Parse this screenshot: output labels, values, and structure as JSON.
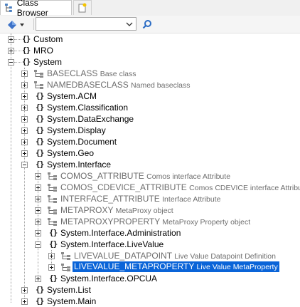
{
  "tabs": {
    "class_browser": "Class Browser"
  },
  "toolbar": {
    "search_value": "",
    "search_placeholder": ""
  },
  "tree": {
    "custom": "Custom",
    "mro": "MRO",
    "system": "System",
    "baseclass_name": "BASECLASS",
    "baseclass_desc": "Base class",
    "namedbaseclass_name": "NAMEDBASECLASS",
    "namedbaseclass_desc": "Named baseclass",
    "acm": "System.ACM",
    "classification": "System.Classification",
    "dataexchange": "System.DataExchange",
    "display": "System.Display",
    "document": "System.Document",
    "geo": "System.Geo",
    "interface": "System.Interface",
    "comos_attribute_name": "COMOS_ATTRIBUTE",
    "comos_attribute_desc": "Comos interface Attribute",
    "comos_cdevice_name": "COMOS_CDEVICE_ATTRIBUTE",
    "comos_cdevice_desc": "Comos CDEVICE interface Attribute",
    "interface_attribute_name": "INTERFACE_ATTRIBUTE",
    "interface_attribute_desc": "Interface Attribute",
    "metaproxy_name": "METAPROXY",
    "metaproxy_desc": "MetaProxy object",
    "metaproxyproperty_name": "METAPROXYPROPERTY",
    "metaproxyproperty_desc": "MetaProxy Property object",
    "administration": "System.Interface.Administration",
    "livevalue": "System.Interface.LiveValue",
    "lv_datapoint_name": "LIVEVALUE_DATAPOINT",
    "lv_datapoint_desc": "Live Value Datapoint Definition",
    "lv_metaproperty_name": "LIVEVALUE_METAPROPERTY",
    "lv_metaproperty_desc": "Live Value MetaProperty",
    "opcua": "System.Interface.OPCUA",
    "list": "System.List",
    "main": "System.Main"
  }
}
